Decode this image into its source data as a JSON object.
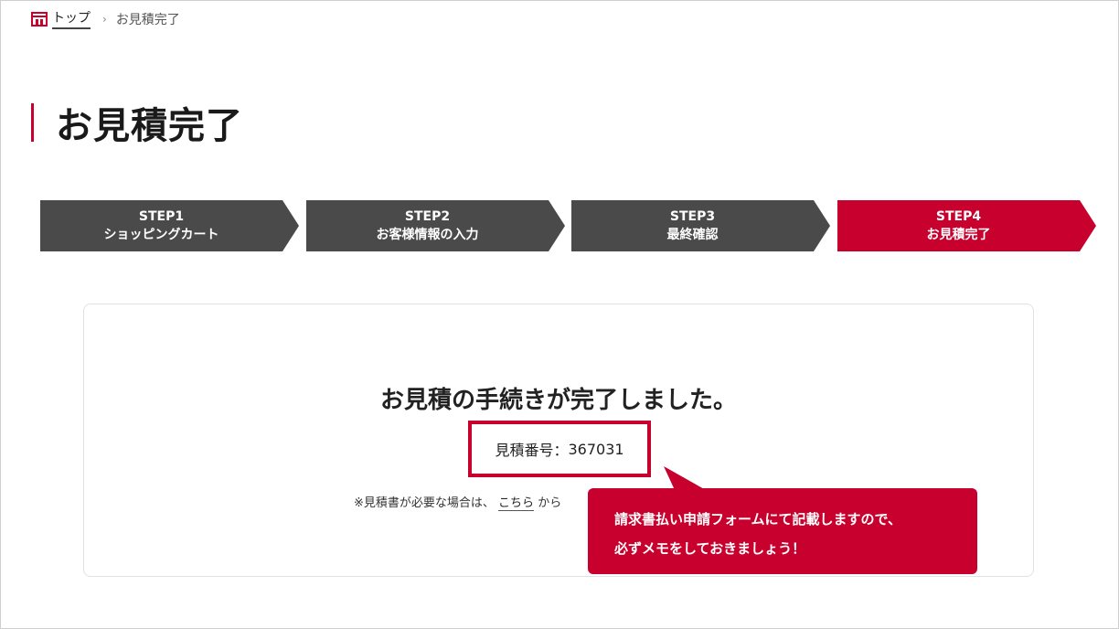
{
  "breadcrumb": {
    "home_label": "トップ",
    "separator": "›",
    "current_label": "お見積完了"
  },
  "page": {
    "title": "お見積完了"
  },
  "steps": [
    {
      "num": "STEP1",
      "label": "ショッピングカート",
      "active": false
    },
    {
      "num": "STEP2",
      "label": "お客様情報の入力",
      "active": false
    },
    {
      "num": "STEP3",
      "label": "最終確認",
      "active": false
    },
    {
      "num": "STEP4",
      "label": "お見積完了",
      "active": true
    }
  ],
  "main": {
    "heading": "お見積の手続きが完了しました。",
    "quote_label": "見積番号：",
    "quote_number": "367031",
    "note_prefix": "※見積書が必要な場合は、",
    "note_link": "こちら",
    "note_suffix": "から"
  },
  "callout": {
    "line1": "請求書払い申請フォームにて記載しますので、",
    "line2": "必ずメモをしておきましょう！"
  },
  "colors": {
    "accent": "#c8002d",
    "step_inactive": "#4a4a4a",
    "border": "#e2e2e2"
  },
  "icons": {
    "home": "home-icon"
  }
}
